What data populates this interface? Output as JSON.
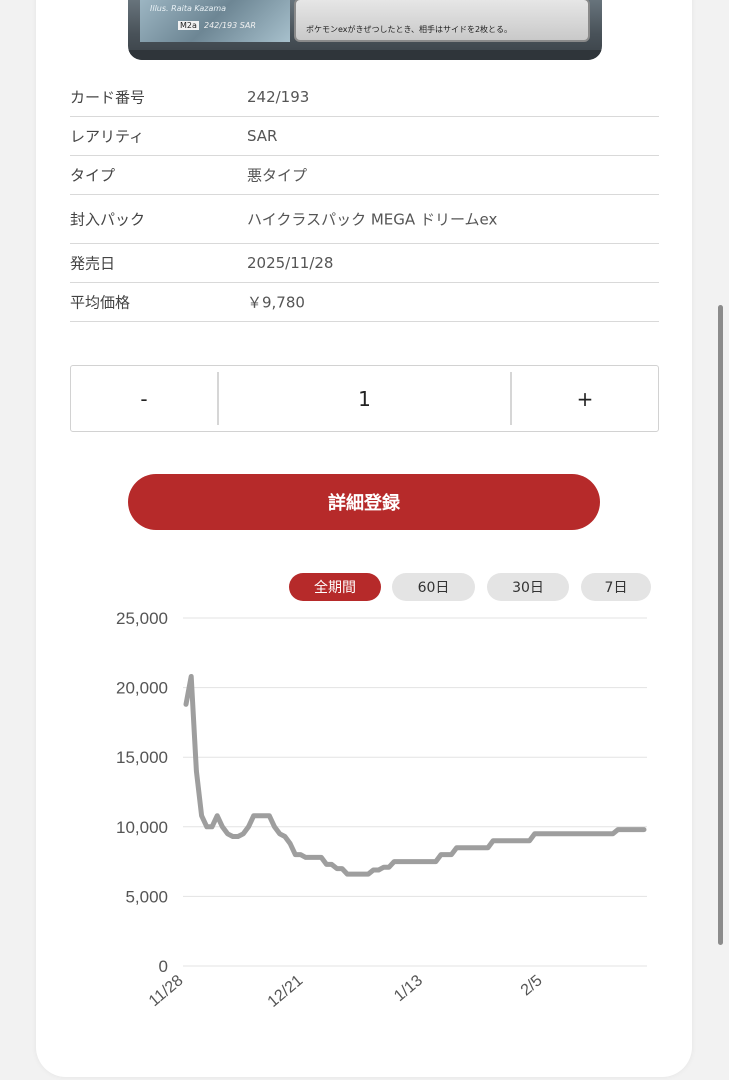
{
  "card_image": {
    "illus_text": "Illus. Raita Kazama",
    "set_code": "M2a",
    "number_text": "242/193 SAR",
    "effect_text": "ポケモンexがきぜつしたとき、相手はサイドを2枚とる。"
  },
  "details": [
    {
      "label": "カード番号",
      "value": "242/193"
    },
    {
      "label": "レアリティ",
      "value": "SAR"
    },
    {
      "label": "タイプ",
      "value": "悪タイプ"
    },
    {
      "label": "封入パック",
      "value": "ハイクラスパック MEGA ドリームex"
    },
    {
      "label": "発売日",
      "value": "2025/11/28"
    },
    {
      "label": "平均価格",
      "value": "￥9,780"
    }
  ],
  "quantity": {
    "minus_label": "-",
    "value": "1",
    "plus_label": "+"
  },
  "register_button": "詳細登録",
  "ranges": [
    {
      "label": "全期間",
      "active": true
    },
    {
      "label": "60日",
      "active": false
    },
    {
      "label": "30日",
      "active": false
    },
    {
      "label": "7日",
      "active": false
    }
  ],
  "colors": {
    "accent": "#b62a2a",
    "line": "#9e9e9e",
    "grid": "#e3e3e3",
    "pill": "#e4e4e4"
  },
  "chart_data": {
    "type": "line",
    "title": "",
    "xlabel": "",
    "ylabel": "",
    "ylim": [
      0,
      25000
    ],
    "yticks": [
      "0",
      "5,000",
      "10,000",
      "15,000",
      "20,000",
      "25,000"
    ],
    "xtick_labels": [
      "11/28",
      "12/21",
      "1/13",
      "2/5"
    ],
    "grid": true,
    "series": [
      {
        "x": [
          "11/28",
          "11/29",
          "11/30",
          "12/1",
          "12/2",
          "12/3",
          "12/4",
          "12/5",
          "12/6",
          "12/7",
          "12/8",
          "12/9",
          "12/10",
          "12/11",
          "12/12",
          "12/13",
          "12/14",
          "12/15",
          "12/16",
          "12/17",
          "12/18",
          "12/19",
          "12/20",
          "12/21",
          "12/22",
          "12/23",
          "12/24",
          "12/25",
          "12/26",
          "12/27",
          "12/28",
          "12/29",
          "12/30",
          "12/31",
          "1/1",
          "1/2",
          "1/3",
          "1/4",
          "1/5",
          "1/6",
          "1/7",
          "1/8",
          "1/9",
          "1/10",
          "1/11",
          "1/12",
          "1/13",
          "1/14",
          "1/15",
          "1/16",
          "1/17",
          "1/18",
          "1/19",
          "1/20",
          "1/21",
          "1/22",
          "1/23",
          "1/24",
          "1/25",
          "1/26",
          "1/27",
          "1/28",
          "1/29",
          "1/30",
          "1/31",
          "2/1",
          "2/2",
          "2/3",
          "2/4",
          "2/5",
          "2/6",
          "2/7",
          "2/8",
          "2/9",
          "2/10",
          "2/11",
          "2/12",
          "2/13",
          "2/14",
          "2/15",
          "2/16",
          "2/17",
          "2/18",
          "2/19",
          "2/20",
          "2/21",
          "2/22",
          "2/23",
          "2/24"
        ],
        "values": [
          18800,
          20800,
          14000,
          10800,
          10000,
          10000,
          10800,
          10000,
          9500,
          9300,
          9300,
          9500,
          10000,
          10800,
          10800,
          10800,
          10800,
          10000,
          9500,
          9300,
          8800,
          8000,
          8000,
          7800,
          7800,
          7800,
          7800,
          7300,
          7300,
          7000,
          7000,
          6600,
          6600,
          6600,
          6600,
          6600,
          6900,
          6900,
          7100,
          7100,
          7500,
          7500,
          7500,
          7500,
          7500,
          7500,
          7500,
          7500,
          7500,
          8000,
          8000,
          8000,
          8500,
          8500,
          8500,
          8500,
          8500,
          8500,
          8500,
          9000,
          9000,
          9000,
          9000,
          9000,
          9000,
          9000,
          9000,
          9500,
          9500,
          9500,
          9500,
          9500,
          9500,
          9500,
          9500,
          9500,
          9500,
          9500,
          9500,
          9500,
          9500,
          9500,
          9500,
          9800,
          9800,
          9800,
          9800,
          9800,
          9800
        ]
      }
    ]
  }
}
